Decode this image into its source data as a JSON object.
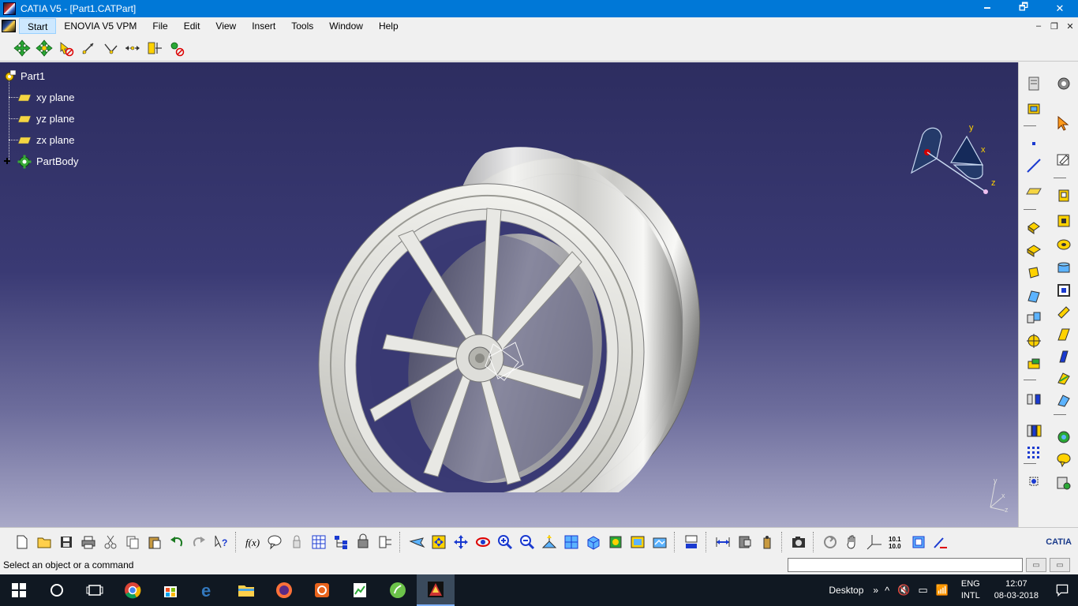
{
  "window": {
    "title": "CATIA V5 - [Part1.CATPart]",
    "minimize": "🗕",
    "maximize": "🗗",
    "close": "✕"
  },
  "menubar": {
    "items": [
      {
        "label": "Start",
        "active": true
      },
      {
        "label": "ENOVIA V5 VPM"
      },
      {
        "label": "File"
      },
      {
        "label": "Edit"
      },
      {
        "label": "View"
      },
      {
        "label": "Insert"
      },
      {
        "label": "Tools"
      },
      {
        "label": "Window"
      },
      {
        "label": "Help"
      }
    ],
    "child_minimize": "–",
    "child_restore": "❐",
    "child_close": "✕"
  },
  "toptoolbar": {
    "icons": [
      "move-compass-icon",
      "snap-icon",
      "manipulate-icon",
      "rotate-axis-icon",
      "angle-icon",
      "distance-icon",
      "measure-icon",
      "analysis-icon"
    ]
  },
  "tree": {
    "root": "Part1",
    "planes": [
      "xy plane",
      "yz plane",
      "zx plane"
    ],
    "body": "PartBody"
  },
  "compass": {
    "x_label": "x",
    "y_label": "y",
    "z_label": "z"
  },
  "bottomtoolbar": {
    "icons": [
      "new-icon",
      "open-icon",
      "save-icon",
      "print-icon",
      "cut-icon",
      "copy-icon",
      "paste-icon",
      "undo-icon",
      "redo-icon",
      "whats-this-icon",
      "formula-icon",
      "comment-icon",
      "lock-icon",
      "catalog-icon",
      "tree-icon",
      "scan-icon",
      "update-icon",
      "fly-icon",
      "fit-all-icon",
      "pan-icon",
      "rotate-icon",
      "zoom-in-icon",
      "zoom-out-icon",
      "normal-view-icon",
      "multi-view-icon",
      "iso-view-icon",
      "shading-icon",
      "hide-show-icon",
      "swap-icon",
      "publish-icon",
      "measure-between-icon",
      "measure-item-icon",
      "mass-icon",
      "capture-icon",
      "refresh-icon",
      "grab-icon",
      "axis-system-icon",
      "grid-icon",
      "toolbar-icon",
      "sketch-icon"
    ],
    "logo": "CATIA"
  },
  "status": {
    "message": "Select an object or a command",
    "command_value": ""
  },
  "taskbar": {
    "desktop_label": "Desktop",
    "chevron": "»",
    "lang_top": "ENG",
    "lang_bottom": "INTL",
    "time": "12:07",
    "date": "08-03-2018"
  },
  "colors": {
    "titlebar": "#0078d7",
    "viewport_top": "#2d2d60",
    "viewport_bottom": "#a9a9c8",
    "taskbar": "#101822"
  }
}
